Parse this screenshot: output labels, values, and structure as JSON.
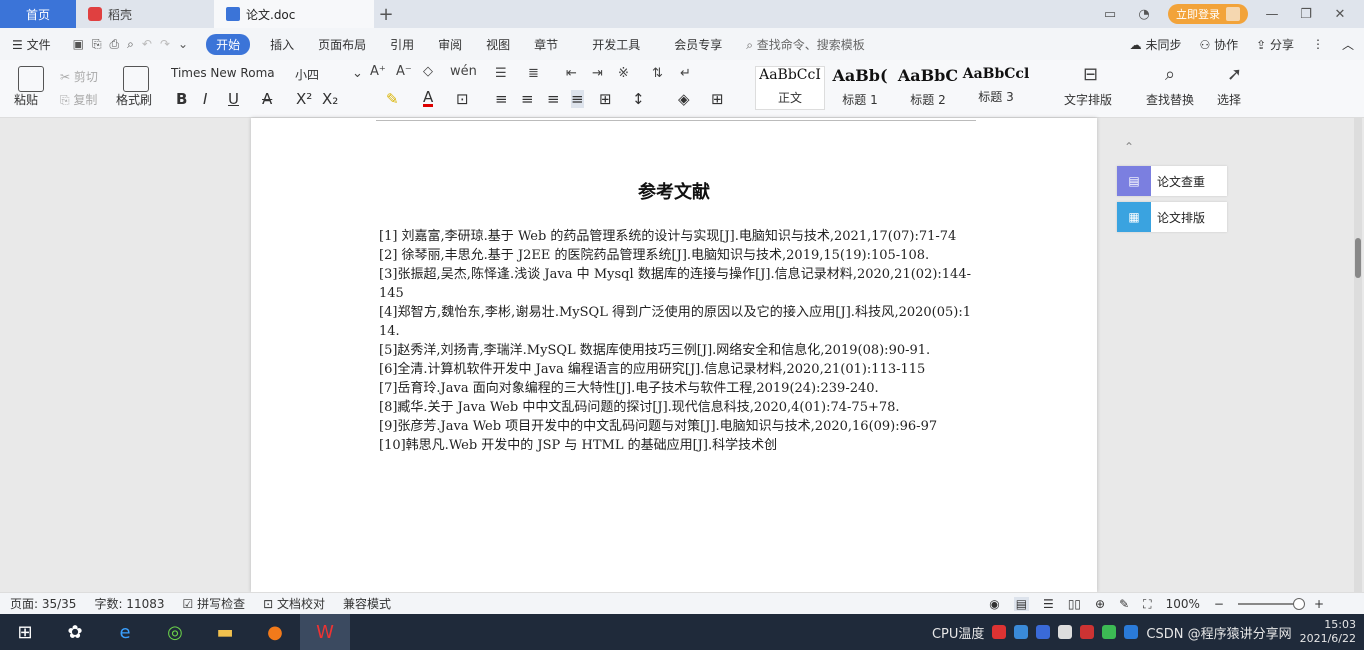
{
  "tabs": {
    "home": "首页",
    "docer": "稻壳",
    "document": "论文.doc",
    "login": "立即登录"
  },
  "menu": {
    "file": "文件",
    "items": [
      "开始",
      "插入",
      "页面布局",
      "引用",
      "审阅",
      "视图",
      "章节",
      "开发工具",
      "会员专享"
    ],
    "search": "查找命令、搜索模板",
    "sync": "未同步",
    "collab": "协作",
    "share": "分享"
  },
  "ribbon": {
    "paste": "粘贴",
    "cut": "剪切",
    "copy": "复制",
    "format_painter": "格式刷",
    "font_name": "Times New Roma",
    "font_size": "小四",
    "styles": [
      {
        "sample": "AaBbCcI",
        "label": "正文"
      },
      {
        "sample": "AaBb(",
        "label": "标题 1"
      },
      {
        "sample": "AaBbC",
        "label": "标题 2"
      },
      {
        "sample": "AaBbCcl",
        "label": "标题 3"
      }
    ],
    "text_layout": "文字排版",
    "find_replace": "查找替换",
    "select": "选择"
  },
  "document": {
    "title": "参考文献",
    "references": [
      "[1] 刘嘉富,李研琼.基于 Web 的药品管理系统的设计与实现[J].电脑知识与技术,2021,17(07):71-74",
      "[2] 徐琴丽,丰思允.基于 J2EE 的医院药品管理系统[J].电脑知识与技术,2019,15(19):105-108.",
      "[3]张振超,吴杰,陈怿逢.浅谈 Java 中 Mysql 数据库的连接与操作[J].信息记录材料,2020,21(02):144-145",
      "[4]郑智方,魏怡东,李彬,谢易壮.MySQL 得到广泛使用的原因以及它的接入应用[J].科技风,2020(05):114.",
      "[5]赵秀洋,刘扬青,李瑞洋.MySQL 数据库使用技巧三例[J].网络安全和信息化,2019(08):90-91.",
      "[6]全清.计算机软件开发中 Java 编程语言的应用研究[J].信息记录材料,2020,21(01):113-115",
      "[7]岳育玲.Java 面向对象编程的三大特性[J].电子技术与软件工程,2019(24):239-240.",
      "[8]臧华.关于 Java Web 中中文乱码问题的探讨[J].现代信息科技,2020,4(01):74-75+78.",
      "[9]张彦芳.Java Web 项目开发中的中文乱码问题与对策[J].电脑知识与技术,2020,16(09):96-97",
      "[10]韩思凡.Web 开发中的 JSP 与 HTML 的基础应用[J].科学技术创"
    ]
  },
  "side_panel": {
    "check": "论文查重",
    "layout": "论文排版"
  },
  "status": {
    "page": "页面: 35/35",
    "words": "字数: 11083",
    "spell": "拼写检查",
    "proof": "文档校对",
    "compat": "兼容模式",
    "zoom": "100%"
  },
  "taskbar": {
    "csdn": "CSDN @程序猿讲分享网",
    "cpu": "CPU温度",
    "time": "15:03",
    "date": "2021/6/22"
  },
  "colors": {
    "accent": "#3b74d8",
    "login": "#f2a33a",
    "taskbar": "#1f2a3a"
  }
}
